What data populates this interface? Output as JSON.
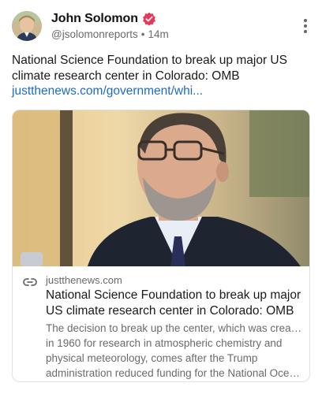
{
  "post": {
    "author": {
      "name": "John Solomon",
      "handle": "@jsolomonreports",
      "time": "14m",
      "verified_color": "#e8375a"
    },
    "text": "National Science Foundation to break up major US climate research center in Colorado: OMB",
    "link_text": "justthenews.com/government/whi...",
    "card": {
      "domain": "justthenews.com",
      "title": "National Science Foundation to break up major US climate research center in Colorado: OMB",
      "description_lines": [
        "The decision to break up the center, which was created",
        "in 1960 for research in atmospheric chemistry and",
        "physical meteorology, comes after the Trump",
        "administration reduced funding for the National Ocea..."
      ]
    }
  },
  "icons": {
    "verified": "verified-badge-icon",
    "more": "more-vertical-icon",
    "link": "link-icon"
  },
  "colors": {
    "link": "#1d6cc2",
    "secondary_text": "#6b6b6b"
  }
}
